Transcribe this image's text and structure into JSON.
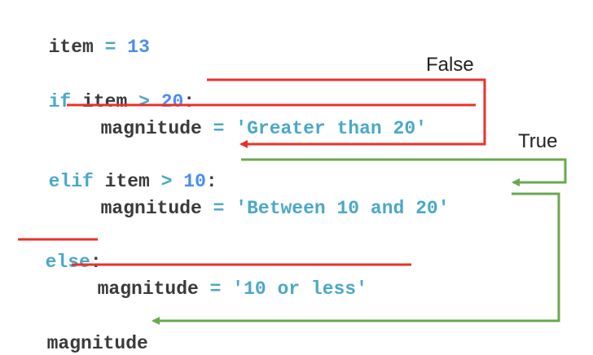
{
  "code": {
    "line1": {
      "var": "item",
      "op": "=",
      "num": "13"
    },
    "line2": {
      "kw": "if",
      "var": "item",
      "op": ">",
      "num": "20",
      "colon": ":"
    },
    "line3": {
      "var": "magnitude",
      "op": "=",
      "str": "'Greater than 20'"
    },
    "line4": {
      "kw": "elif",
      "var": "item",
      "op": ">",
      "num": "10",
      "colon": ":"
    },
    "line5": {
      "var": "magnitude",
      "op": "=",
      "str": "'Between 10 and 20'"
    },
    "line6": {
      "kw": "else",
      "colon": ":"
    },
    "line7": {
      "var": "magnitude",
      "op": "=",
      "str": "'10 or less'"
    },
    "line8": {
      "var": "magnitude"
    }
  },
  "labels": {
    "false_label": "False",
    "true_label": "True"
  },
  "colors": {
    "false_path": "#e8322a",
    "true_path": "#6aa84f",
    "keyword": "#4aa8c8",
    "number": "#4a8ef0"
  }
}
